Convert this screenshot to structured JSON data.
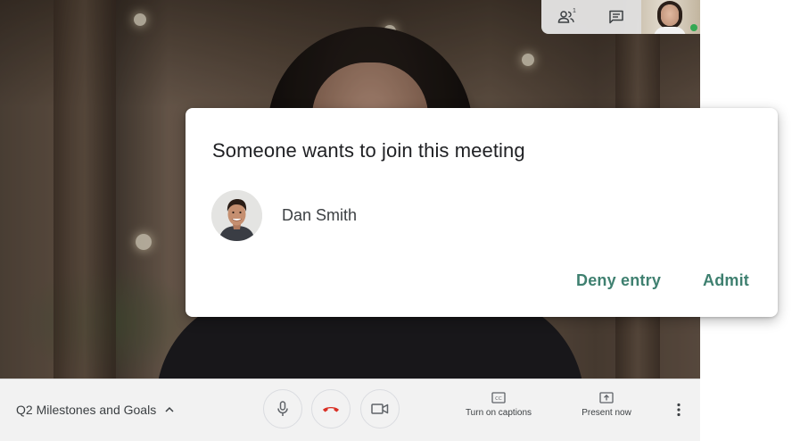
{
  "meeting": {
    "title": "Q2 Milestones and Goals",
    "participant_count": "1"
  },
  "dialog": {
    "title": "Someone wants to join this meeting",
    "requester_name": "Dan Smith",
    "deny_label": "Deny entry",
    "admit_label": "Admit"
  },
  "bottom_bar": {
    "captions_label": "Turn on captions",
    "present_label": "Present now"
  },
  "icons": {
    "people": "people-icon",
    "chat": "chat-icon",
    "mic": "mic-icon",
    "hangup": "hang-up-icon",
    "camera": "camera-icon",
    "captions": "captions-icon",
    "present": "present-icon",
    "more": "more-vert-icon"
  },
  "colors": {
    "accent": "#3f8070",
    "hangup": "#d93025",
    "bar_bg": "#f2f2f2",
    "text_dark": "#202124"
  }
}
